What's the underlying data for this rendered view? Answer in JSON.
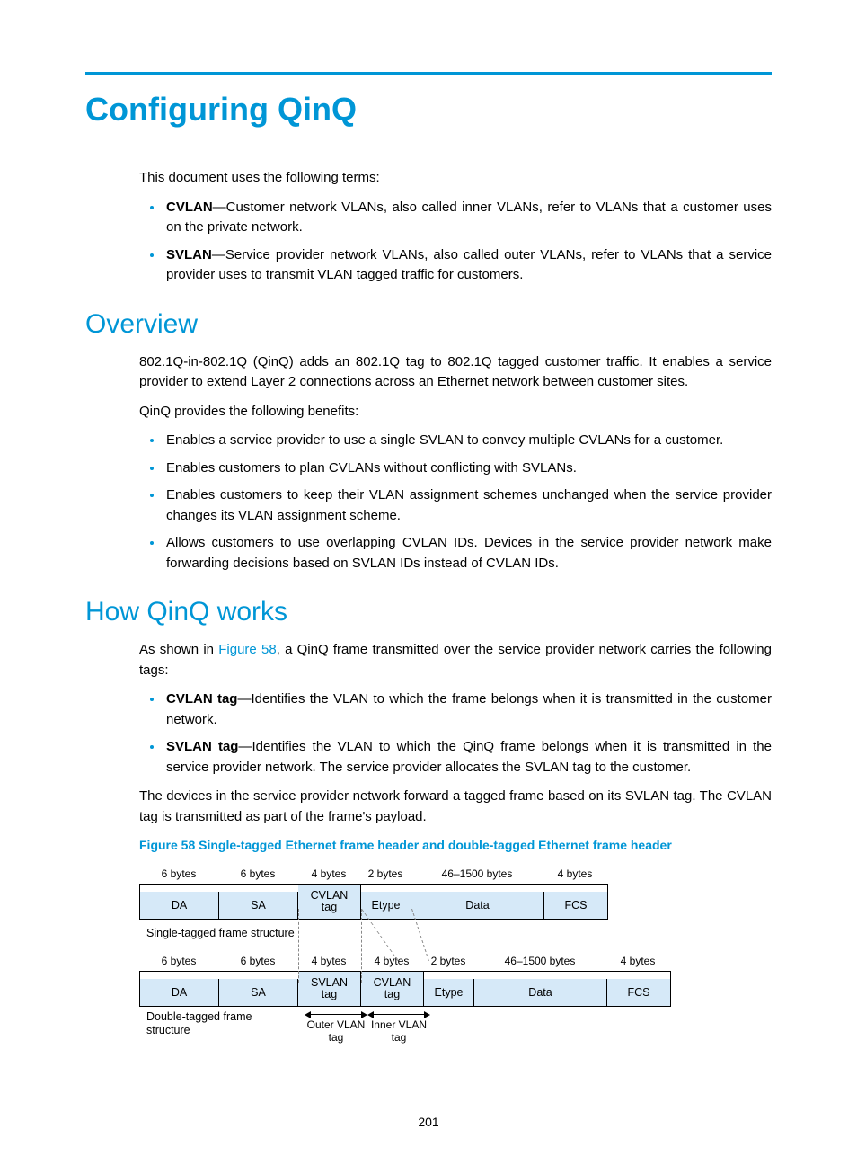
{
  "page_number": "201",
  "title": "Configuring QinQ",
  "intro": "This document uses the following terms:",
  "terms": [
    {
      "name": "CVLAN",
      "desc": "—Customer network VLANs, also called inner VLANs, refer to VLANs that a customer uses on the private network."
    },
    {
      "name": "SVLAN",
      "desc": "—Service provider network VLANs, also called outer VLANs, refer to VLANs that a service provider uses to transmit VLAN tagged traffic for customers."
    }
  ],
  "sections": {
    "overview": {
      "heading": "Overview",
      "p1": "802.1Q-in-802.1Q (QinQ) adds an 802.1Q tag to 802.1Q tagged customer traffic. It enables a service provider to extend Layer 2 connections across an Ethernet network between customer sites.",
      "p2": "QinQ provides the following benefits:",
      "benefits": [
        "Enables a service provider to use a single SVLAN to convey multiple CVLANs for a customer.",
        "Enables customers to plan CVLANs without conflicting with SVLANs.",
        "Enables customers to keep their VLAN assignment schemes unchanged when the service provider changes its VLAN assignment scheme.",
        "Allows customers to use overlapping CVLAN IDs. Devices in the service provider network make forwarding decisions based on SVLAN IDs instead of CVLAN IDs."
      ]
    },
    "how": {
      "heading": "How QinQ works",
      "p1_pre": "As shown in ",
      "p1_link": "Figure 58",
      "p1_post": ", a QinQ frame transmitted over the service provider network carries the following tags:",
      "tags": [
        {
          "name": "CVLAN tag",
          "desc": "—Identifies the VLAN to which the frame belongs when it is transmitted in the customer network."
        },
        {
          "name": "SVLAN tag",
          "desc": "—Identifies the VLAN to which the QinQ frame belongs when it is transmitted in the service provider network. The service provider allocates the SVLAN tag to the customer."
        }
      ],
      "p2": "The devices in the service provider network forward a tagged frame based on its SVLAN tag. The CVLAN tag is transmitted as part of the frame's payload."
    }
  },
  "figure": {
    "caption": "Figure 58 Single-tagged Ethernet frame header and double-tagged Ethernet frame header",
    "single_label": "Single-tagged frame structure",
    "double_label": "Double-tagged frame structure",
    "outer_label": "Outer VLAN tag",
    "inner_label": "Inner VLAN tag",
    "single": {
      "sizes": [
        "6 bytes",
        "6 bytes",
        "4 bytes",
        "2 bytes",
        "46–1500 bytes",
        "4 bytes"
      ],
      "fields": [
        "DA",
        "SA",
        "CVLAN tag",
        "Etype",
        "Data",
        "FCS"
      ]
    },
    "double": {
      "sizes": [
        "6 bytes",
        "6 bytes",
        "4 bytes",
        "4 bytes",
        "2 bytes",
        "46–1500 bytes",
        "4 bytes"
      ],
      "fields": [
        "DA",
        "SA",
        "SVLAN tag",
        "CVLAN tag",
        "Etype",
        "Data",
        "FCS"
      ]
    }
  }
}
